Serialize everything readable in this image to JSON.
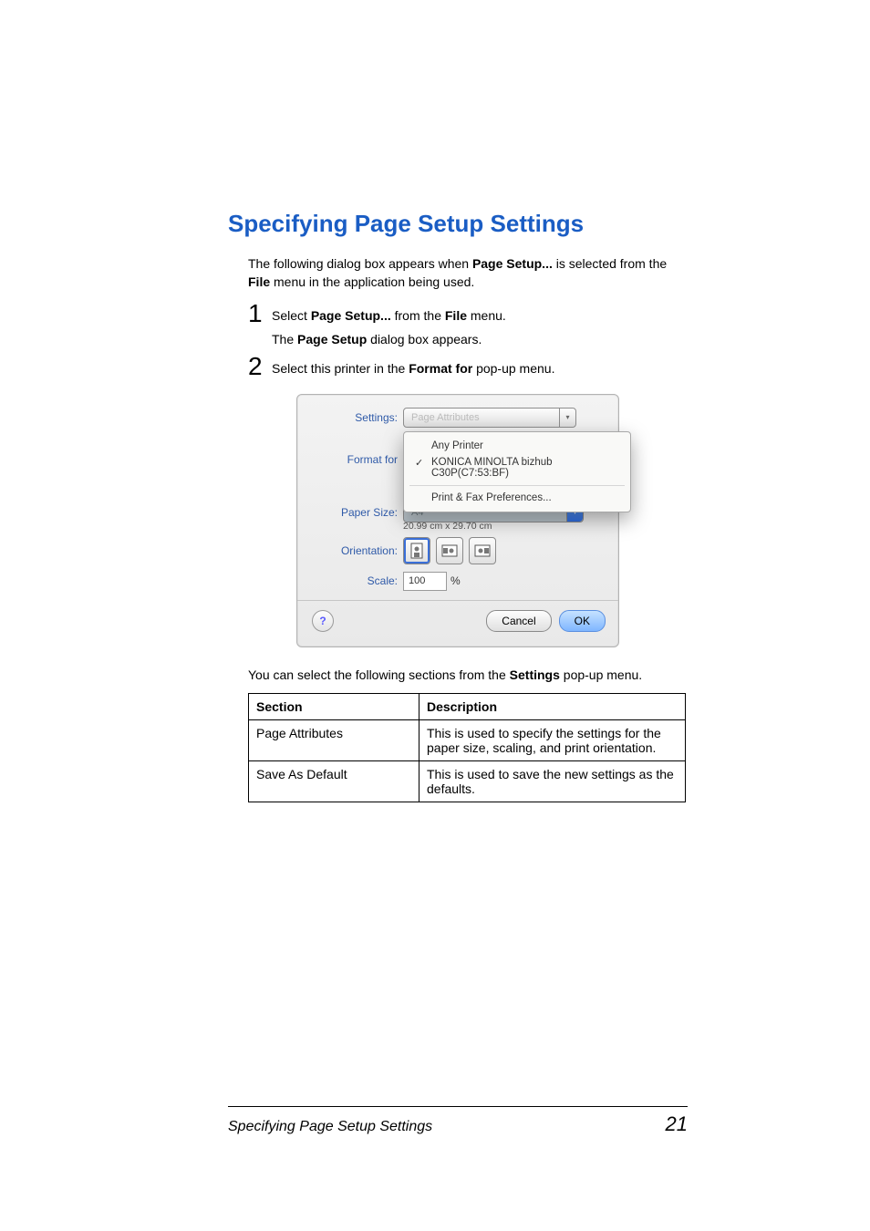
{
  "heading": "Specifying Page Setup Settings",
  "intro_parts": {
    "t1": "The following dialog box appears when ",
    "b1": "Page Setup...",
    "t2": " is selected from the ",
    "b2": "File",
    "t3": " menu in the application being used."
  },
  "steps": [
    {
      "num": "1",
      "parts": {
        "t1": "Select ",
        "b1": "Page Setup...",
        "t2": " from the ",
        "b2": "File",
        "t3": " menu."
      },
      "sub_parts": {
        "t1": "The ",
        "b1": "Page Setup",
        "t2": " dialog box appears."
      }
    },
    {
      "num": "2",
      "parts": {
        "t1": "Select this printer in the ",
        "b1": "Format for",
        "t2": " pop-up menu."
      }
    }
  ],
  "dialog": {
    "labels": {
      "settings": "Settings:",
      "format_for": "Format for",
      "paper": "Paper Size:",
      "orientation": "Orientation:",
      "scale": "Scale:"
    },
    "settings_value": "Page Attributes",
    "menu": {
      "any": "Any Printer",
      "sel": "KONICA MINOLTA bizhub C30P(C7:53:BF)",
      "prefs": "Print & Fax Preferences..."
    },
    "paper_value": "A4",
    "paper_dims": "20.99 cm x 29.70 cm",
    "scale_value": "100",
    "scale_pct": "%",
    "help": "?",
    "cancel": "Cancel",
    "ok": "OK"
  },
  "lead_in_parts": {
    "t1": "You can select the following sections from the ",
    "b1": "Settings",
    "t2": " pop-up menu."
  },
  "table": {
    "head": {
      "c1": "Section",
      "c2": "Description"
    },
    "rows": [
      {
        "c1": "Page Attributes",
        "c2": "This is used to specify the settings for the paper size, scaling, and print orientation."
      },
      {
        "c1": "Save As Default",
        "c2": "This is used to save the new settings as the defaults."
      }
    ]
  },
  "footer": {
    "title": "Specifying Page Setup Settings",
    "page": "21"
  }
}
